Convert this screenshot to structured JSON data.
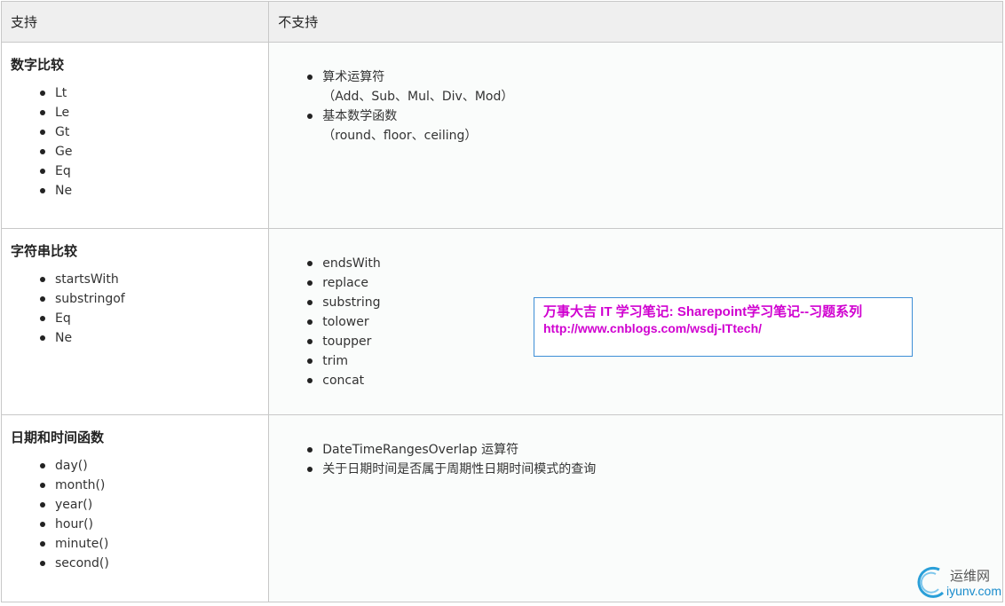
{
  "header": {
    "supported": "支持",
    "unsupported": "不支持"
  },
  "rows": [
    {
      "title": "数字比较",
      "supported": [
        "Lt",
        "Le",
        "Gt",
        "Ge",
        "Eq",
        "Ne"
      ],
      "unsupported": [
        {
          "main": "算术运算符",
          "sub": "（Add、Sub、Mul、Div、Mod）"
        },
        {
          "main": "基本数学函数",
          "sub": "（round、floor、ceiling）"
        }
      ]
    },
    {
      "title": "字符串比较",
      "supported": [
        "startsWith",
        "substringof",
        "Eq",
        "Ne"
      ],
      "unsupported": [
        {
          "main": "endsWith"
        },
        {
          "main": "replace"
        },
        {
          "main": "substring"
        },
        {
          "main": "tolower"
        },
        {
          "main": "toupper"
        },
        {
          "main": "trim"
        },
        {
          "main": "concat"
        }
      ]
    },
    {
      "title": "日期和时间函数",
      "supported": [
        "day()",
        "month()",
        "year()",
        "hour()",
        "minute()",
        "second()"
      ],
      "unsupported": [
        {
          "main": "DateTimeRangesOverlap 运算符"
        },
        {
          "main": "关于日期时间是否属于周期性日期时间模式的查询"
        }
      ]
    }
  ],
  "watermark": {
    "line1": "万事大吉 IT 学习笔记: Sharepoint学习笔记--习题系列",
    "line2": "http://www.cnblogs.com/wsdj-ITtech/",
    "color": "#d000d0"
  },
  "logo": {
    "cn": "运维网",
    "en": "iyunv.com",
    "icon": "swirl-logo-icon"
  }
}
